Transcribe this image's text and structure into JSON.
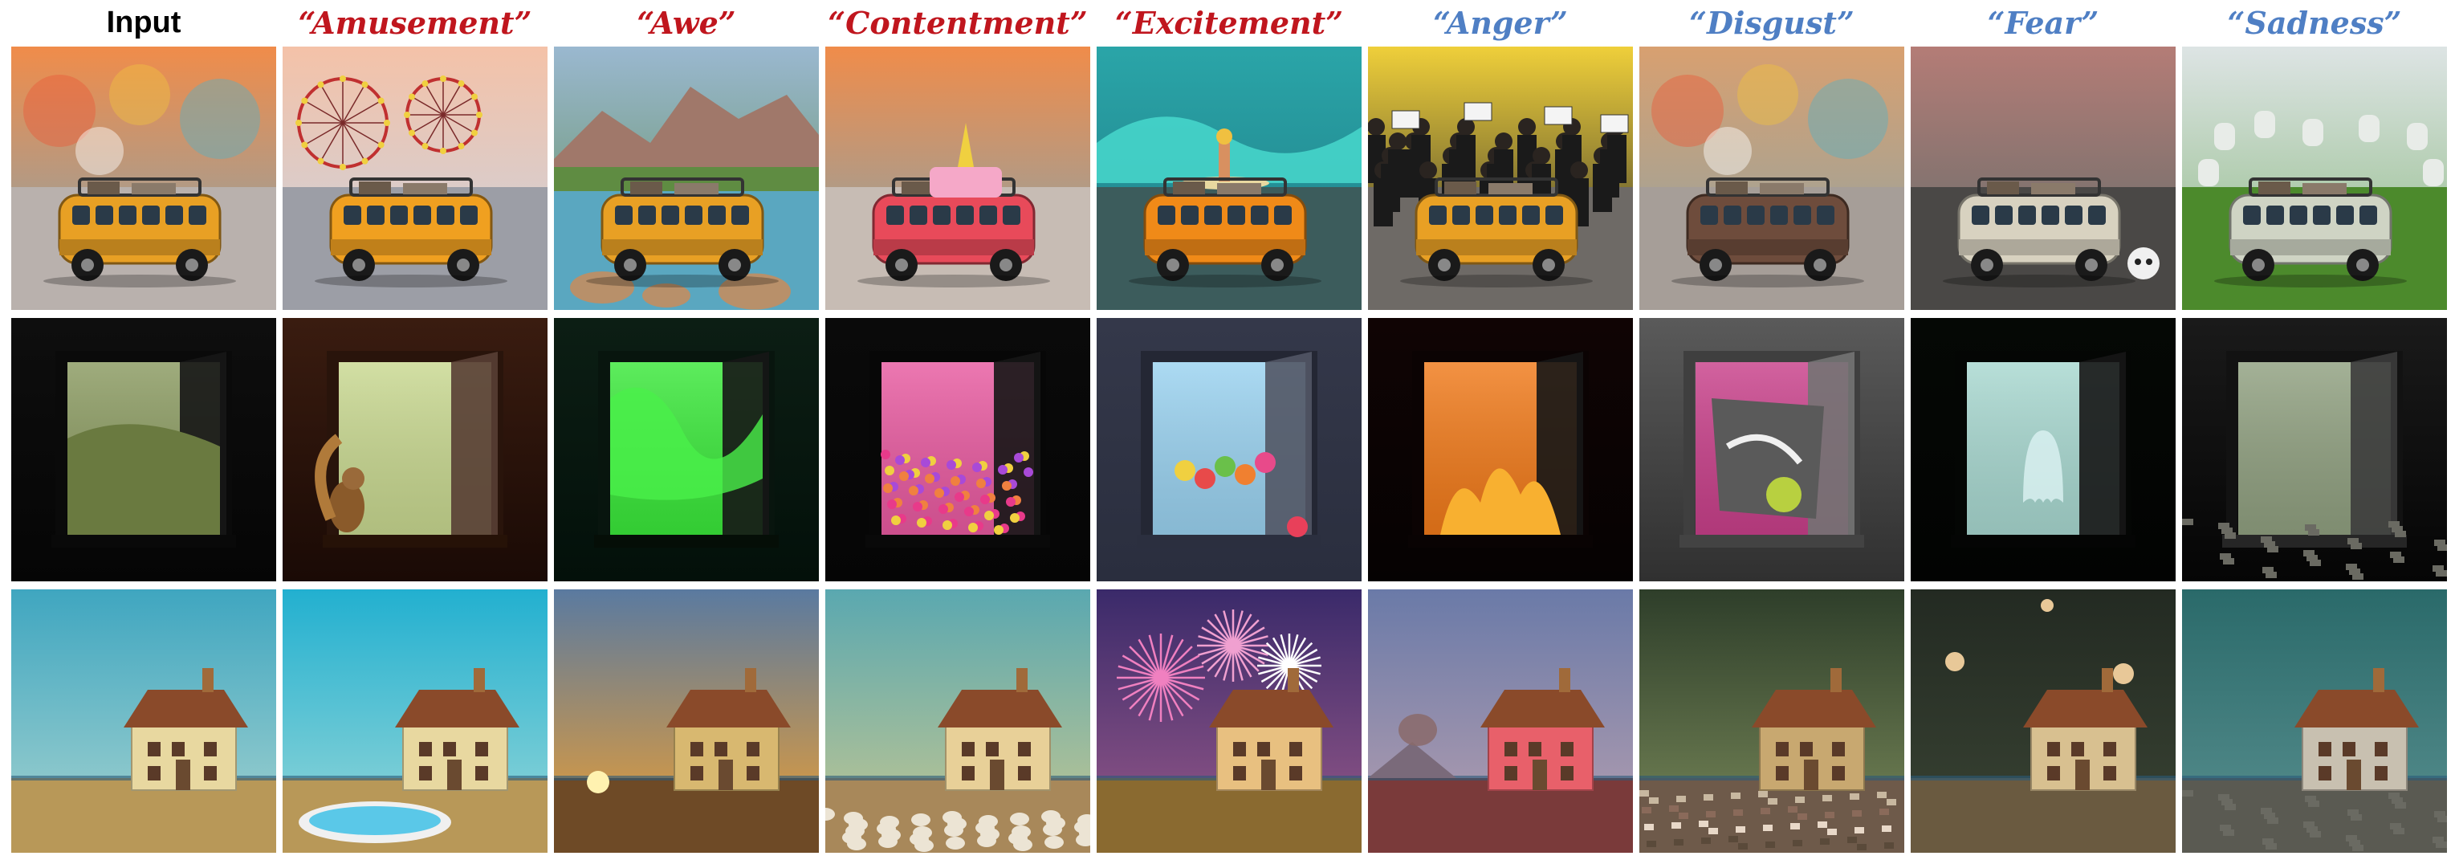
{
  "figure": {
    "columns": [
      {
        "label": "Input",
        "kind": "input",
        "color": "#000000"
      },
      {
        "label": "“Amusement”",
        "kind": "positive",
        "color": "#c0161e"
      },
      {
        "label": "“Awe”",
        "kind": "positive",
        "color": "#c0161e"
      },
      {
        "label": "“Contentment”",
        "kind": "positive",
        "color": "#c0161e"
      },
      {
        "label": "“Excitement”",
        "kind": "positive",
        "color": "#c0161e"
      },
      {
        "label": "“Anger”",
        "kind": "negative",
        "color": "#4f7fc4"
      },
      {
        "label": "“Disgust”",
        "kind": "negative",
        "color": "#4f7fc4"
      },
      {
        "label": "“Fear”",
        "kind": "negative",
        "color": "#4f7fc4"
      },
      {
        "label": "“Sadness”",
        "kind": "negative",
        "color": "#4f7fc4"
      }
    ],
    "rows": [
      {
        "subject": "van",
        "tiles": [
          {
            "scene": "input",
            "sky": [
              "#f08c4a",
              "#7ea6b6"
            ],
            "ground": "#b9b1ad",
            "object": "#e8a024",
            "extra": "bokeh"
          },
          {
            "scene": "amusement",
            "sky": [
              "#f4c2a8",
              "#c7d4e4"
            ],
            "ground": "#9c9ea6",
            "object": "#f0a020",
            "extra": "ferris-wheel"
          },
          {
            "scene": "awe",
            "sky": [
              "#9ab8d0",
              "#5f8c52"
            ],
            "ground": "#5aa7c0",
            "object": "#e8a024",
            "extra": "mountains"
          },
          {
            "scene": "contentment",
            "sky": [
              "#f08c4a",
              "#7ea6b6"
            ],
            "ground": "#c7bcb4",
            "object": "#e84a5a",
            "extra": "cake"
          },
          {
            "scene": "excitement",
            "sky": [
              "#2aa5a8",
              "#1f7c86"
            ],
            "ground": "#3c5c5c",
            "object": "#f08a18",
            "extra": "surfer"
          },
          {
            "scene": "anger",
            "sky": [
              "#efcf3a",
              "#2a2a2a"
            ],
            "ground": "#6e6a66",
            "object": "#e8a024",
            "extra": "crowd"
          },
          {
            "scene": "disgust",
            "sky": [
              "#d8a070",
              "#8aa4a8"
            ],
            "ground": "#a69e98",
            "object": "#6e4c3c",
            "extra": "bokeh"
          },
          {
            "scene": "fear",
            "sky": [
              "#b47c76",
              "#5c6c6a"
            ],
            "ground": "#4a4846",
            "object": "#d8d2c0",
            "extra": "skull"
          },
          {
            "scene": "sadness",
            "sky": [
              "#dde4e4",
              "#8ab880"
            ],
            "ground": "#4c8a2c",
            "object": "#cfd4c4",
            "extra": "graves"
          }
        ]
      },
      {
        "subject": "window",
        "tiles": [
          {
            "scene": "input",
            "sky": [
              "#0e0e0e",
              "#050505"
            ],
            "ground": "#0a0a0a",
            "object": "#8a9a60",
            "extra": "valley"
          },
          {
            "scene": "amusement",
            "sky": [
              "#3a1c10",
              "#1a0a05"
            ],
            "ground": "#2a1408",
            "object": "#c8d890",
            "extra": "squirrel"
          },
          {
            "scene": "awe",
            "sky": [
              "#0c1e14",
              "#03100a"
            ],
            "ground": "#051008",
            "object": "#3ae83a",
            "extra": "aurora"
          },
          {
            "scene": "contentment",
            "sky": [
              "#0a0a0a",
              "#050505"
            ],
            "ground": "#0a0a0a",
            "object": "#e85aa0",
            "extra": "flowers"
          },
          {
            "scene": "excitement",
            "sky": [
              "#34384a",
              "#2a2e3e"
            ],
            "ground": "#303446",
            "object": "#9ad2f0",
            "extra": "balloons"
          },
          {
            "scene": "anger",
            "sky": [
              "#100404",
              "#050202"
            ],
            "ground": "#0a0303",
            "object": "#f07a1a",
            "extra": "fire"
          },
          {
            "scene": "disgust",
            "sky": [
              "#5a5a5a",
              "#303030"
            ],
            "ground": "#4a4a4a",
            "object": "#c8408a",
            "extra": "graffiti"
          },
          {
            "scene": "fear",
            "sky": [
              "#050805",
              "#020302"
            ],
            "ground": "#040604",
            "object": "#a8d8d0",
            "extra": "ghost"
          },
          {
            "scene": "sadness",
            "sky": [
              "#1a1a1a",
              "#050505"
            ],
            "ground": "#2a2a2a",
            "object": "#90a080",
            "extra": "ruin"
          }
        ]
      },
      {
        "subject": "house",
        "tiles": [
          {
            "scene": "input",
            "sky": [
              "#3fa6c0",
              "#a8d4d0"
            ],
            "ground": "#b89858",
            "object": "#e8d8a0",
            "extra": "none"
          },
          {
            "scene": "amusement",
            "sky": [
              "#22b0d0",
              "#9ad8d8"
            ],
            "ground": "#b89858",
            "object": "#e8d8a0",
            "extra": "pool"
          },
          {
            "scene": "awe",
            "sky": [
              "#5a7aa0",
              "#f0a030"
            ],
            "ground": "#6e4a26",
            "object": "#d8b870",
            "extra": "sunset"
          },
          {
            "scene": "contentment",
            "sky": [
              "#5aa8b0",
              "#c8c890"
            ],
            "ground": "#a8885a",
            "object": "#e8d098",
            "extra": "sheep"
          },
          {
            "scene": "excitement",
            "sky": [
              "#3a2a6a",
              "#9a5a8a"
            ],
            "ground": "#8a6a30",
            "object": "#e8c080",
            "extra": "fireworks"
          },
          {
            "scene": "anger",
            "sky": [
              "#6a7aa8",
              "#b8a0b0"
            ],
            "ground": "#7a3a3a",
            "object": "#e8606a",
            "extra": "volcano"
          },
          {
            "scene": "disgust",
            "sky": [
              "#2e3e2a",
              "#7a8a5a"
            ],
            "ground": "#6e5a4a",
            "object": "#c8a870",
            "extra": "trash"
          },
          {
            "scene": "fear",
            "sky": [
              "#232a22",
              "#3a4434"
            ],
            "ground": "#6a5a40",
            "object": "#d8c090",
            "extra": "moons"
          },
          {
            "scene": "sadness",
            "sky": [
              "#2a6a6a",
              "#5a9090"
            ],
            "ground": "#5a5a52",
            "object": "#c8c0b0",
            "extra": "ruin"
          }
        ]
      }
    ]
  }
}
